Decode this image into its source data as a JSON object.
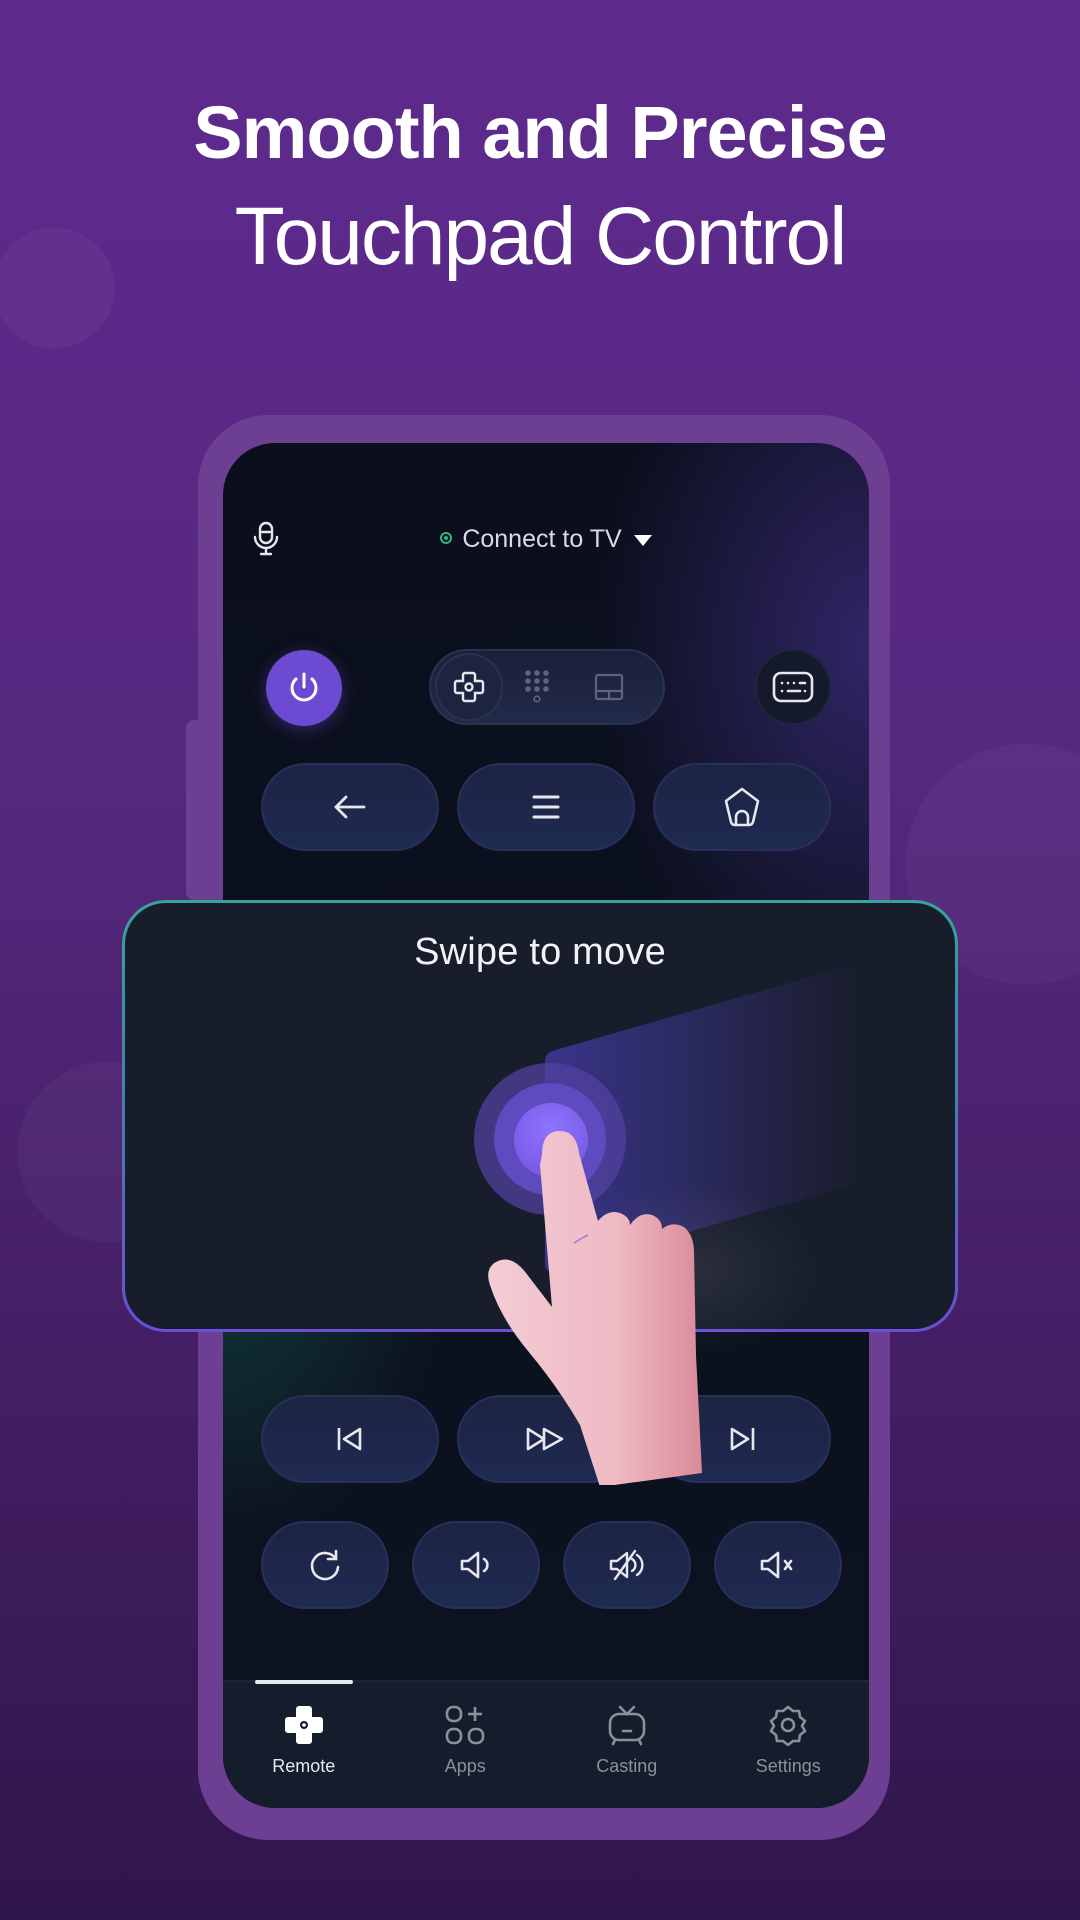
{
  "headline": {
    "line1": "Smooth and Precise",
    "line2": "Touchpad Control"
  },
  "remote": {
    "header": {
      "mic_icon": "microphone-icon",
      "connection_label": "Connect to TV",
      "connection_status_color": "#2fb67e",
      "dropdown_icon": "caret-down-icon"
    },
    "controls": {
      "power_icon": "power-icon",
      "power_color": "#6c4ad1",
      "mode_switch": [
        {
          "icon": "dpad-icon",
          "active": true
        },
        {
          "icon": "numpad-icon",
          "active": false
        },
        {
          "icon": "touchpad-icon",
          "active": false
        }
      ],
      "keyboard_icon": "keyboard-icon"
    },
    "nav_buttons": [
      {
        "icon": "back-arrow-icon",
        "name": "back"
      },
      {
        "icon": "menu-icon",
        "name": "menu"
      },
      {
        "icon": "home-icon",
        "name": "home"
      }
    ],
    "media_buttons": [
      {
        "icon": "previous-icon",
        "name": "previous"
      },
      {
        "icon": "fast-forward-icon",
        "name": "fast-forward"
      },
      {
        "icon": "next-icon",
        "name": "next"
      }
    ],
    "volume_buttons": [
      {
        "icon": "refresh-icon",
        "name": "replay"
      },
      {
        "icon": "volume-down-icon",
        "name": "volume-down"
      },
      {
        "icon": "volume-up-icon",
        "name": "volume-up"
      },
      {
        "icon": "mute-icon",
        "name": "mute"
      }
    ]
  },
  "tabbar": {
    "tabs": [
      {
        "label": "Remote",
        "icon": "remote-icon",
        "active": true
      },
      {
        "label": "Apps",
        "icon": "apps-icon",
        "active": false
      },
      {
        "label": "Casting",
        "icon": "tv-icon",
        "active": false
      },
      {
        "label": "Settings",
        "icon": "gear-icon",
        "active": false
      }
    ]
  },
  "overlay": {
    "title": "Swipe to move",
    "accent_color": "#7153e0"
  }
}
